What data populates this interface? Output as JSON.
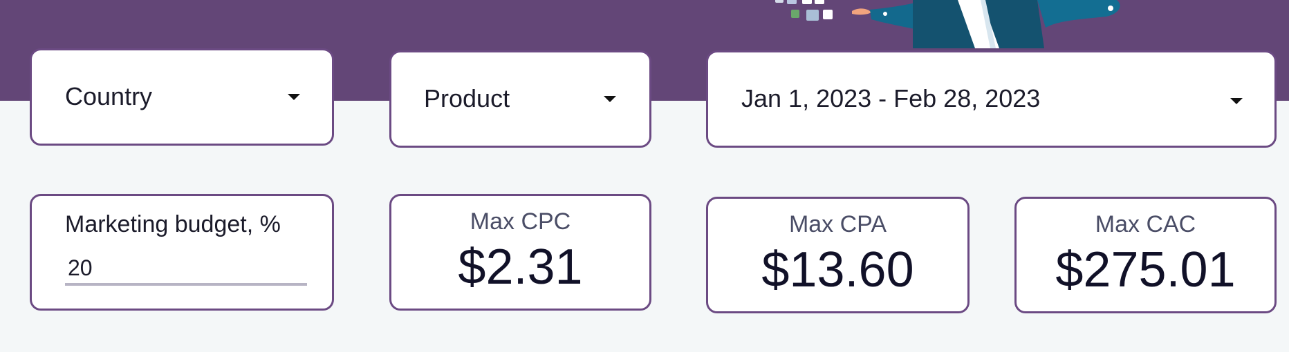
{
  "colors": {
    "header_background": "#634677",
    "card_border": "#6b4a83",
    "page_background": "#f4f7f8"
  },
  "filters": {
    "country": {
      "label": "Country",
      "icon": "chevron-down-icon"
    },
    "product": {
      "label": "Product",
      "icon": "chevron-down-icon"
    },
    "date_range": {
      "label": "Jan 1, 2023 - Feb 28, 2023",
      "icon": "chevron-down-icon"
    }
  },
  "budget": {
    "label": "Marketing budget, %",
    "value": "20"
  },
  "metrics": {
    "max_cpc": {
      "label": "Max CPC",
      "value": "$2.31"
    },
    "max_cpa": {
      "label": "Max CPA",
      "value": "$13.60"
    },
    "max_cac": {
      "label": "Max CAC",
      "value": "$275.01"
    }
  }
}
